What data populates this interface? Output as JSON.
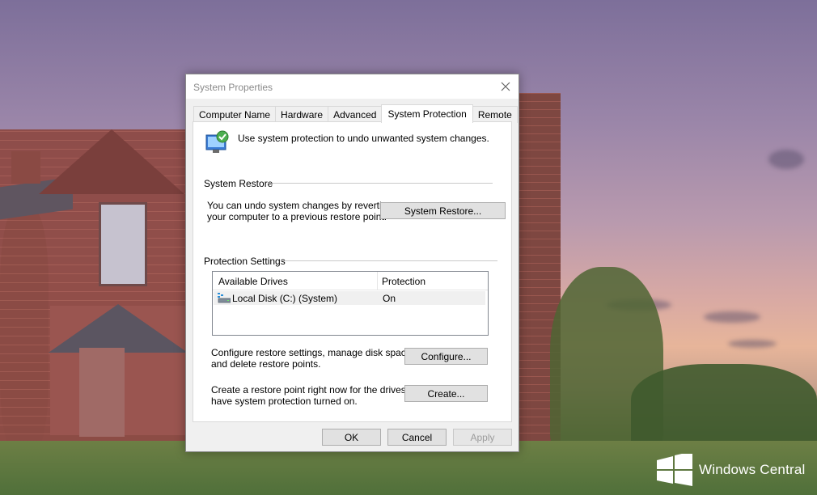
{
  "dialog": {
    "title": "System Properties",
    "tabs": [
      {
        "label": "Computer Name",
        "active": false
      },
      {
        "label": "Hardware",
        "active": false
      },
      {
        "label": "Advanced",
        "active": false
      },
      {
        "label": "System Protection",
        "active": true
      },
      {
        "label": "Remote",
        "active": false
      }
    ],
    "intro_text": "Use system protection to undo unwanted system changes.",
    "system_restore": {
      "group_label": "System Restore",
      "description_line1": "You can undo system changes by reverting",
      "description_line2": "your computer to a previous restore point.",
      "button_label": "System Restore..."
    },
    "protection_settings": {
      "group_label": "Protection Settings",
      "columns": [
        "Available Drives",
        "Protection"
      ],
      "drives": [
        {
          "name": "Local Disk (C:) (System)",
          "protection": "On",
          "icon": "drive-icon"
        }
      ],
      "configure_line1": "Configure restore settings, manage disk space,",
      "configure_line2": "and delete restore points.",
      "configure_button": "Configure...",
      "create_line1": "Create a restore point right now for the drives that",
      "create_line2": "have system protection turned on.",
      "create_button": "Create..."
    },
    "buttons": {
      "ok": "OK",
      "cancel": "Cancel",
      "apply": "Apply",
      "apply_enabled": false
    }
  },
  "watermark": {
    "text": "Windows Central"
  },
  "colors": {
    "dialog_bg": "#f0f0f0",
    "panel_bg": "#ffffff",
    "title_text": "#8a8a8a",
    "disabled_text": "#9c9c9c"
  }
}
